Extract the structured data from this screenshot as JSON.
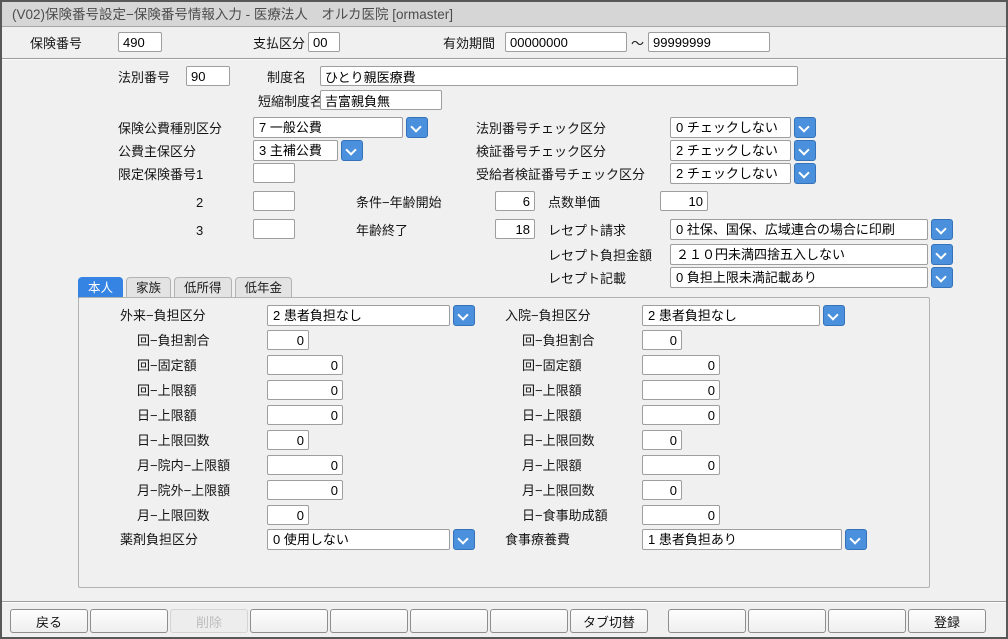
{
  "window": {
    "title": "(V02)保険番号設定−保険番号情報入力 - 医療法人　オルカ医院 [ormaster]"
  },
  "header": {
    "insurance_number": {
      "label": "保険番号",
      "value": "490"
    },
    "payment_class": {
      "label": "支払区分",
      "value": "00"
    },
    "valid_period": {
      "label": "有効期間",
      "from": "00000000",
      "separator": "～",
      "to": "99999999"
    }
  },
  "form": {
    "law_number": {
      "label": "法別番号",
      "value": "90"
    },
    "system_name": {
      "label": "制度名",
      "value": "ひとり親医療費"
    },
    "short_system_name": {
      "label": "短縮制度名",
      "value": "吉富親負無"
    },
    "insurance_public_type": {
      "label": "保険公費種別区分",
      "value": "7 一般公費"
    },
    "law_number_check": {
      "label": "法別番号チェック区分",
      "value": "0 チェックしない"
    },
    "public_main_class": {
      "label": "公費主保区分",
      "value": "3 主補公費"
    },
    "verify_number_check": {
      "label": "検証番号チェック区分",
      "value": "2 チェックしない"
    },
    "recipient_verify_check": {
      "label": "受給者検証番号チェック区分",
      "value": "2 チェックしない"
    },
    "limited_insurance": {
      "label": "限定保険番号",
      "no1": "1",
      "no2": "2",
      "no3": "3",
      "value1": "",
      "value2": "",
      "value3": ""
    },
    "condition_age_start": {
      "label": "条件−年齢開始",
      "value": "6"
    },
    "point_unit_price": {
      "label": "点数単価",
      "value": "10"
    },
    "age_end": {
      "label": "年齢終了",
      "value": "18"
    },
    "receipt_claim": {
      "label": "レセプト請求",
      "value": "0 社保、国保、広域連合の場合に印刷"
    },
    "receipt_burden_amount": {
      "label": "レセプト負担金額",
      "value": "２１０円未満四捨五入しない"
    },
    "receipt_description": {
      "label": "レセプト記載",
      "value": "0 負担上限未満記載あり"
    }
  },
  "tabs": [
    {
      "label": "本人"
    },
    {
      "label": "家族"
    },
    {
      "label": "低所得"
    },
    {
      "label": "低年金"
    }
  ],
  "panel": {
    "left": {
      "burden_class": {
        "label": "外来−負担区分",
        "value": "2 患者負担なし"
      },
      "rows": [
        {
          "label": "回−負担割合",
          "value": "0"
        },
        {
          "label": "回−固定額",
          "value": "0"
        },
        {
          "label": "回−上限額",
          "value": "0"
        },
        {
          "label": "日−上限額",
          "value": "0"
        },
        {
          "label": "日−上限回数",
          "value": "0"
        },
        {
          "label": "月−院内−上限額",
          "value": "0"
        },
        {
          "label": "月−院外−上限額",
          "value": "0"
        },
        {
          "label": "月−上限回数",
          "value": "0"
        }
      ],
      "drug_burden": {
        "label": "薬剤負担区分",
        "value": "0 使用しない"
      }
    },
    "right": {
      "burden_class": {
        "label": "入院−負担区分",
        "value": "2 患者負担なし"
      },
      "rows": [
        {
          "label": "回−負担割合",
          "value": "0"
        },
        {
          "label": "回−固定額",
          "value": "0"
        },
        {
          "label": "回−上限額",
          "value": "0"
        },
        {
          "label": "日−上限額",
          "value": "0"
        },
        {
          "label": "日−上限回数",
          "value": "0"
        },
        {
          "label": "月−上限額",
          "value": "0"
        },
        {
          "label": "月−上限回数",
          "value": "0"
        },
        {
          "label": "日−食事助成額",
          "value": "0"
        }
      ],
      "meal_expense": {
        "label": "食事療養費",
        "value": "1 患者負担あり"
      }
    }
  },
  "footer": {
    "buttons": [
      "戻る",
      "",
      "削除",
      "",
      "",
      "",
      "",
      "タブ切替",
      "",
      "",
      "",
      "登録"
    ]
  },
  "colors": {
    "accent_blue": "#4a90dc",
    "tab_active_blue": "#3584e4"
  }
}
